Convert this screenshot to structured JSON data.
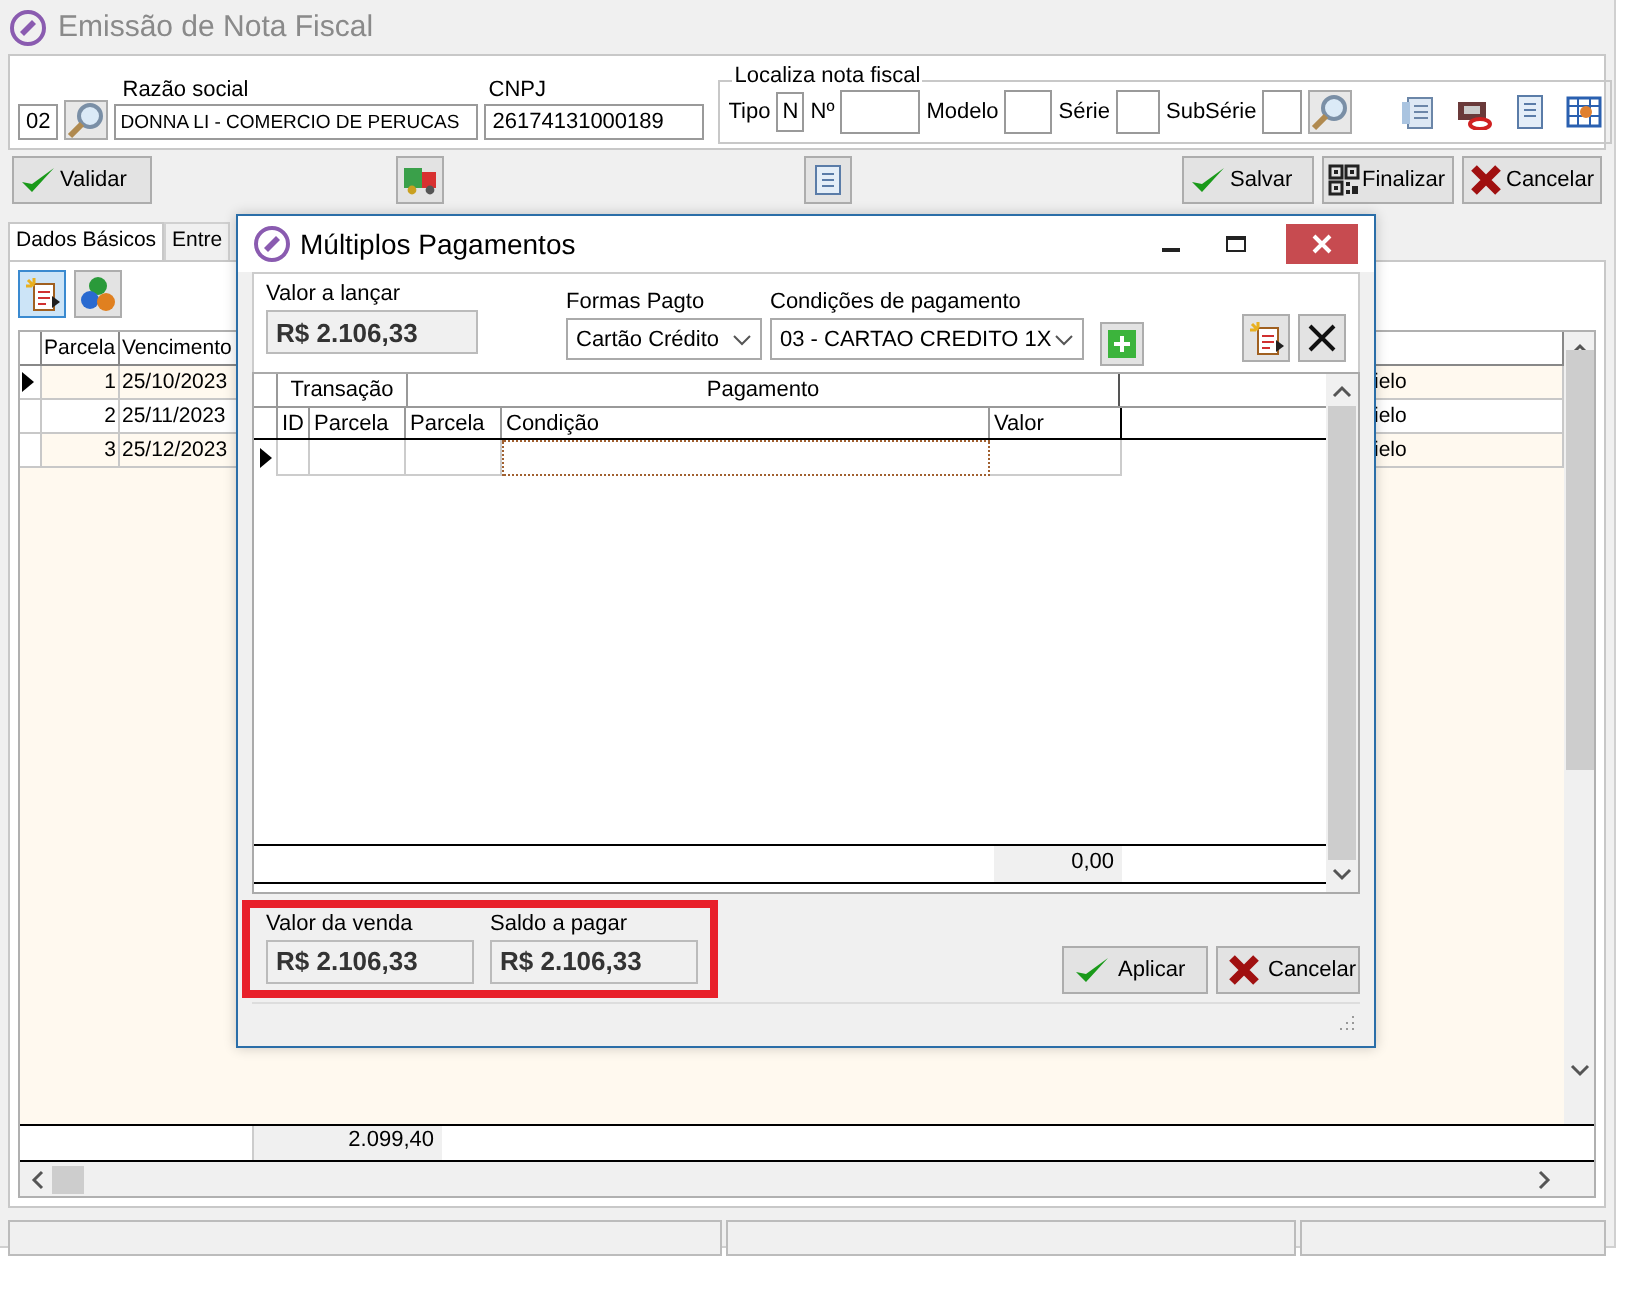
{
  "window": {
    "title": "Emissão de Nota Fiscal"
  },
  "header": {
    "code": "02",
    "razao_label": "Razão social",
    "razao": "DONNA LI - COMERCIO DE PERUCAS",
    "cnpj_label": "CNPJ",
    "cnpj": "26174131000189",
    "localiza": {
      "legend": "Localiza nota fiscal",
      "tipo_label": "Tipo",
      "tipo": "N",
      "numero_label": "Nº",
      "modelo_label": "Modelo",
      "serie_label": "Série",
      "subserie_label": "SubSérie"
    }
  },
  "toolbar": {
    "validar": "Validar",
    "salvar": "Salvar",
    "finalizar": "Finalizar",
    "cancelar": "Cancelar"
  },
  "tabs": [
    {
      "label": "Dados Básicos",
      "selected": true
    },
    {
      "label": "Entre",
      "selected": false
    }
  ],
  "parcelas": {
    "columns": [
      "Parcela",
      "Vencimento"
    ],
    "rows": [
      {
        "parcela": "1",
        "vencimento": "25/10/2023",
        "column_3": "ielo",
        "selected": true
      },
      {
        "parcela": "2",
        "vencimento": "25/11/2023",
        "column_3": "ielo",
        "selected": false
      },
      {
        "parcela": "3",
        "vencimento": "25/12/2023",
        "column_3": "ielo",
        "selected": false
      }
    ],
    "total": "2.099,40"
  },
  "dialog": {
    "title": "Múltiplos Pagamentos",
    "valor_lancar_label": "Valor a lançar",
    "valor_lancar": "R$ 2.106,33",
    "formas_label": "Formas Pagto",
    "forma": "Cartão Crédito",
    "condicoes_label": "Condições de pagamento",
    "condicao": "03 - CARTAO CREDITO 1X",
    "grid": {
      "groups": [
        "Transação",
        "Pagamento"
      ],
      "columns": [
        "ID",
        "Parcela",
        "Parcela",
        "Condição",
        "Valor"
      ],
      "total": "0,00"
    },
    "valor_venda_label": "Valor da venda",
    "valor_venda": "R$ 2.106,33",
    "saldo_label": "Saldo a pagar",
    "saldo": "R$ 2.106,33",
    "buttons": [
      {
        "label": "Aplicar",
        "kind": "apply"
      },
      {
        "label": "Cancelar",
        "kind": "cancel"
      }
    ]
  }
}
